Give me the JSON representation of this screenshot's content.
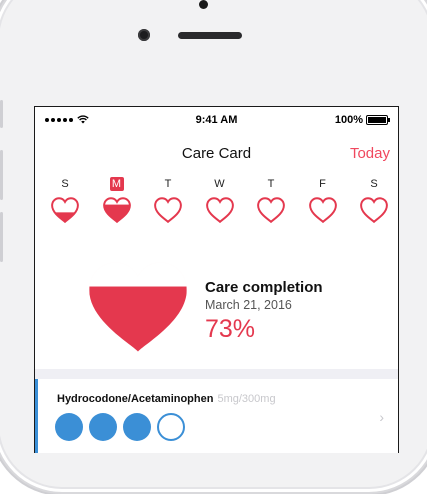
{
  "status_bar": {
    "time": "9:41 AM",
    "battery": "100%"
  },
  "nav": {
    "title": "Care Card",
    "today": "Today"
  },
  "week": [
    {
      "label": "S",
      "fill": 0.4,
      "selected": false
    },
    {
      "label": "M",
      "fill": 0.73,
      "selected": true
    },
    {
      "label": "T",
      "fill": 0,
      "selected": false
    },
    {
      "label": "W",
      "fill": 0,
      "selected": false
    },
    {
      "label": "T",
      "fill": 0,
      "selected": false
    },
    {
      "label": "F",
      "fill": 0,
      "selected": false
    },
    {
      "label": "S",
      "fill": 0,
      "selected": false
    }
  ],
  "summary": {
    "title": "Care completion",
    "date": "March 21, 2016",
    "percent_text": "73%",
    "fill": 0.73
  },
  "activity": {
    "name": "Hydrocodone/Acetaminophen",
    "detail": "5mg/300mg",
    "doses_completed": 3,
    "doses_total": 4
  },
  "colors": {
    "accent": "#e4384e",
    "today": "#f0485e",
    "activity": "#3b8fd6"
  }
}
